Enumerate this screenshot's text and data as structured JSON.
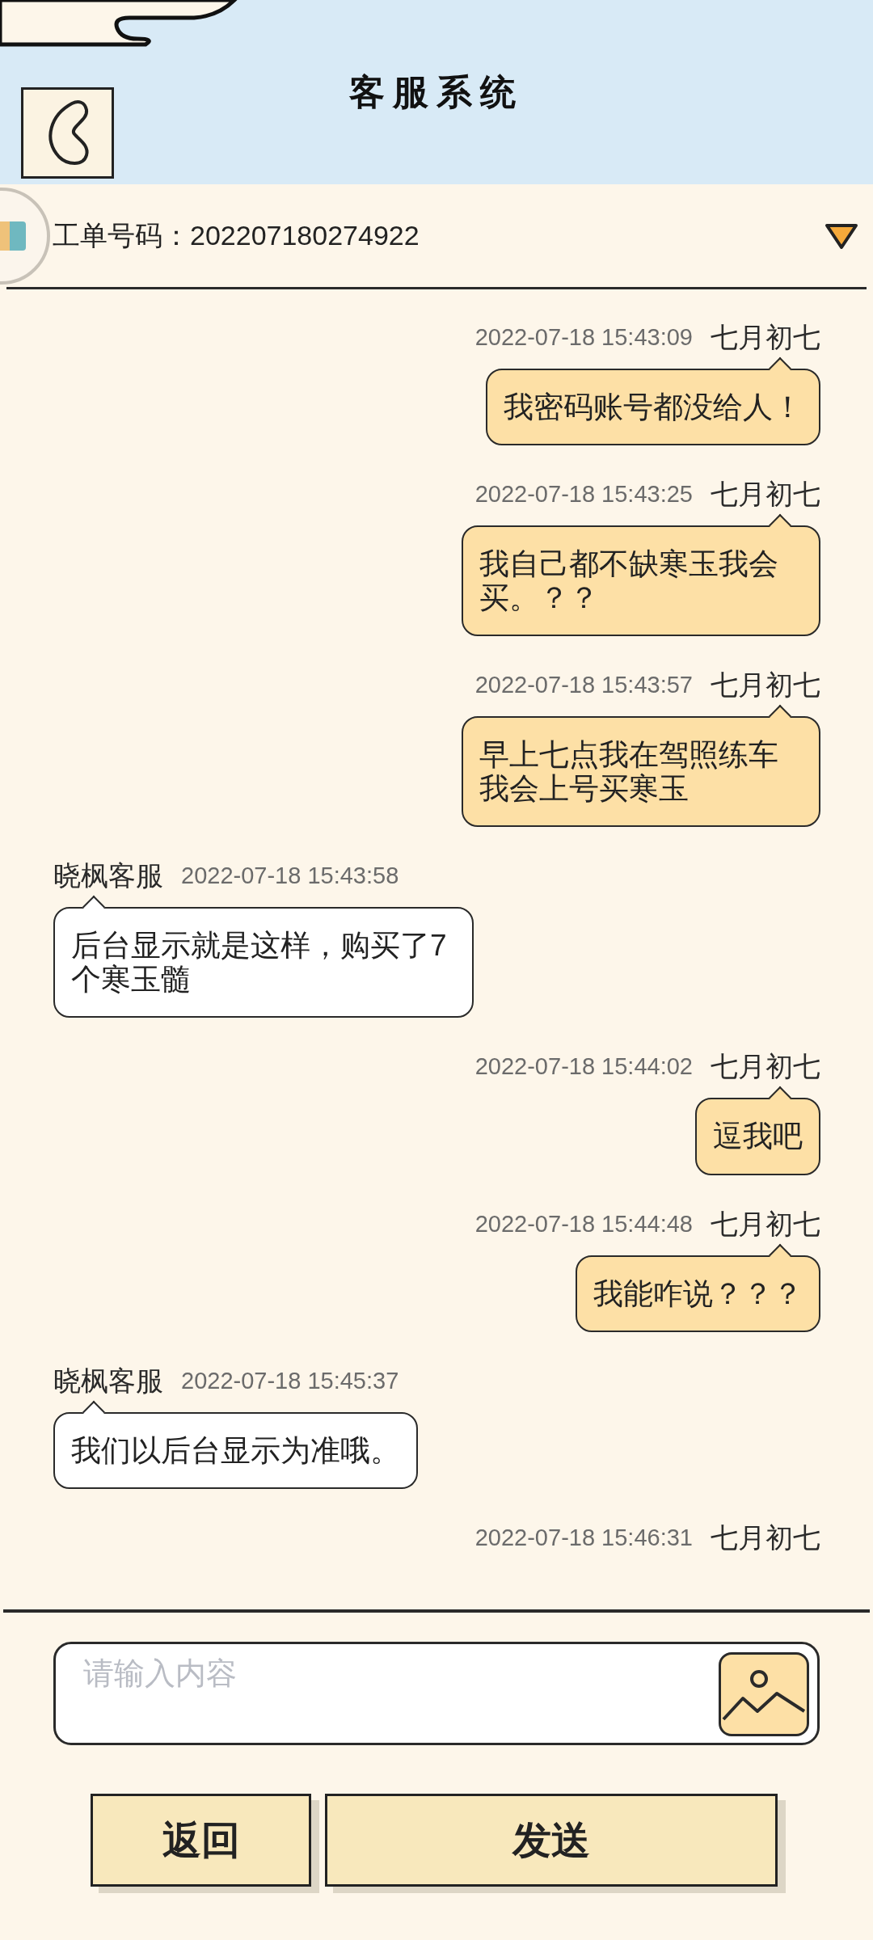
{
  "header": {
    "title": "客服系统"
  },
  "ticket": {
    "label": "工单号码：",
    "number": "202207180274922"
  },
  "messages": [
    {
      "kind": "sent",
      "sender": "七月初七",
      "time": "2022-07-18 15:43:09",
      "text": "我密码账号都没给人！"
    },
    {
      "kind": "sent",
      "sender": "七月初七",
      "time": "2022-07-18 15:43:25",
      "text": "我自己都不缺寒玉我会买。？？"
    },
    {
      "kind": "sent",
      "sender": "七月初七",
      "time": "2022-07-18 15:43:57",
      "text": "早上七点我在驾照练车我会上号买寒玉"
    },
    {
      "kind": "received",
      "sender": "晓枫客服",
      "time": "2022-07-18 15:43:58",
      "text": "后台显示就是这样，购买了7个寒玉髓"
    },
    {
      "kind": "sent",
      "sender": "七月初七",
      "time": "2022-07-18 15:44:02",
      "text": "逗我吧"
    },
    {
      "kind": "sent",
      "sender": "七月初七",
      "time": "2022-07-18 15:44:48",
      "text": "我能咋说？？？"
    },
    {
      "kind": "received",
      "sender": "晓枫客服",
      "time": "2022-07-18 15:45:37",
      "text": "我们以后台显示为准哦。"
    },
    {
      "kind": "sent",
      "sender": "七月初七",
      "time": "2022-07-18 15:46:31"
    }
  ],
  "input": {
    "placeholder": "请输入内容"
  },
  "buttons": [
    "返回",
    "发送"
  ]
}
